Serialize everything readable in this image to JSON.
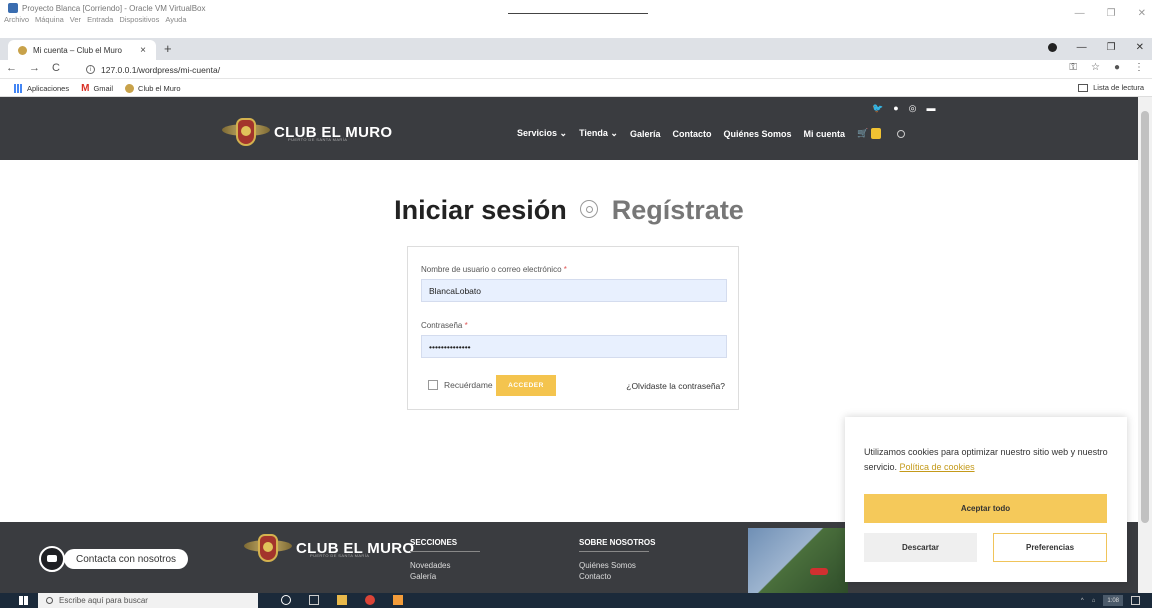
{
  "vbox": {
    "title": "Proyecto Blanca [Corriendo] - Oracle VM VirtualBox",
    "menu": [
      "Archivo",
      "Máquina",
      "Ver",
      "Entrada",
      "Dispositivos",
      "Ayuda"
    ]
  },
  "browser": {
    "tab_title": "Mi cuenta – Club el Muro",
    "url": "127.0.0.1/wordpress/mi-cuenta/",
    "bookmarks": [
      "Aplicaciones",
      "Gmail",
      "Club el Muro"
    ],
    "reading_list": "Lista de lectura"
  },
  "site": {
    "logo_text": "CLUB EL MURO",
    "logo_sub": "PUERTO DE SANTA MARÍA",
    "nav": [
      "Servicios",
      "Tienda",
      "Galería",
      "Contacto",
      "Quiénes Somos",
      "Mi cuenta"
    ],
    "nav_has_dropdown": [
      true,
      true,
      false,
      false,
      false,
      false
    ]
  },
  "login": {
    "title": "Iniciar sesión",
    "register": "Regístrate",
    "username_label": "Nombre de usuario o correo electrónico",
    "username_value": "BlancaLobato",
    "password_label": "Contraseña",
    "password_value": "••••••••••••••",
    "required_mark": "*",
    "remember_label": "Recuérdame",
    "submit_label": "ACCEDER",
    "forgot_label": "¿Olvidaste la contraseña?"
  },
  "footer": {
    "sections_title": "SECCIONES",
    "sections_items": [
      "Novedades",
      "Galería"
    ],
    "about_title": "SOBRE NOSOTROS",
    "about_items": [
      "Quiénes Somos",
      "Contacto"
    ]
  },
  "chat": {
    "label": "Contacta con nosotros"
  },
  "cookie": {
    "text": "Utilizamos cookies para optimizar nuestro sitio web y nuestro servicio.",
    "link": "Política de cookies",
    "accept": "Aceptar todo",
    "discard": "Descartar",
    "preferences": "Preferencias"
  },
  "taskbar": {
    "search_placeholder": "Escribe aquí para buscar",
    "clock": "1:08"
  },
  "colors": {
    "header_bg": "#3a3c40",
    "accent_yellow": "#f4c44e",
    "input_bg": "#e8f0fe"
  }
}
